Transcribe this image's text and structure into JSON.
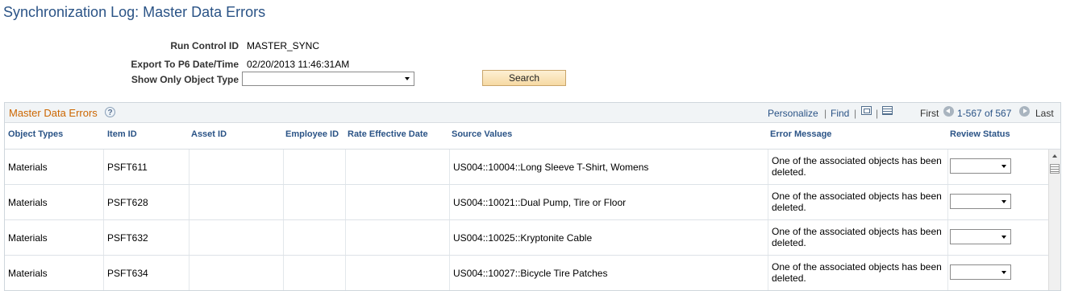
{
  "page": {
    "title": "Synchronization Log: Master Data Errors"
  },
  "form": {
    "run_control_label": "Run Control ID",
    "run_control_value": "MASTER_SYNC",
    "export_label": "Export To P6 Date/Time",
    "export_value": "02/20/2013 11:46:31AM",
    "object_type_label": "Show Only Object Type",
    "object_type_value": "",
    "search_label": "Search"
  },
  "grid": {
    "title": "Master Data Errors",
    "help_icon": "?",
    "personalize": "Personalize",
    "separator": "|",
    "find": "Find",
    "first": "First",
    "range": "1-567 of 567",
    "last": "Last",
    "columns": [
      "Object Types",
      "Item ID",
      "Asset ID",
      "Employee ID",
      "Rate Effective Date",
      "Source Values",
      "Error Message",
      "Review Status"
    ],
    "rows": [
      {
        "object_type": "Materials",
        "item_id": "PSFT611",
        "asset_id": "",
        "employee_id": "",
        "rate_effective_date": "",
        "source_values": "US004::10004::Long Sleeve T-Shirt, Womens",
        "error_message": "One of the associated objects has been deleted.",
        "review_status": ""
      },
      {
        "object_type": "Materials",
        "item_id": "PSFT628",
        "asset_id": "",
        "employee_id": "",
        "rate_effective_date": "",
        "source_values": "US004::10021::Dual Pump, Tire or Floor",
        "error_message": "One of the associated objects has been deleted.",
        "review_status": ""
      },
      {
        "object_type": "Materials",
        "item_id": "PSFT632",
        "asset_id": "",
        "employee_id": "",
        "rate_effective_date": "",
        "source_values": "US004::10025::Kryptonite Cable",
        "error_message": "One of the associated objects has been deleted.",
        "review_status": ""
      },
      {
        "object_type": "Materials",
        "item_id": "PSFT634",
        "asset_id": "",
        "employee_id": "",
        "rate_effective_date": "",
        "source_values": "US004::10027::Bicycle Tire Patches",
        "error_message": "One of the associated objects has been deleted.",
        "review_status": ""
      }
    ]
  },
  "icons": {
    "help": "help-icon",
    "zoom": "zoom-icon",
    "download": "download-icon",
    "prev": "arrow-left-icon",
    "next": "arrow-right-icon",
    "dropdown": "chevron-down-icon"
  }
}
